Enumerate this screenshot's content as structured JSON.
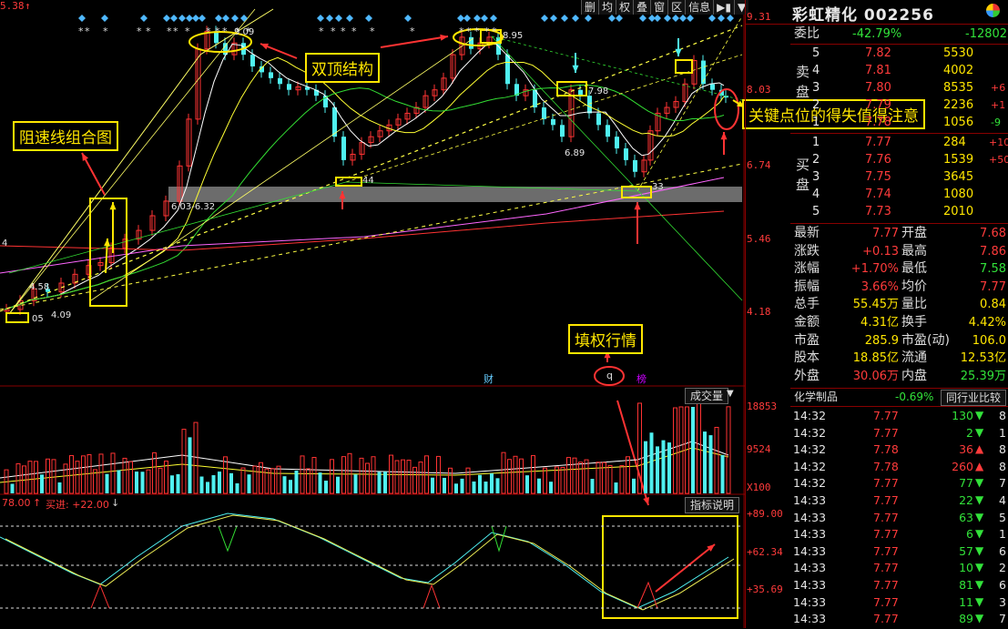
{
  "stock": {
    "name": "彩虹精化",
    "code": "002256"
  },
  "toolbar": [
    "删",
    "均",
    "权",
    "叠",
    "窗",
    "区",
    "信息"
  ],
  "price_axis": [
    "9.31",
    "8.03",
    "6.74",
    "5.46",
    "4.18"
  ],
  "top_left_price": "5.38",
  "chart_labels": {
    "l603": "6.03-6.32",
    "l689": "6.89",
    "l798": "7.98",
    "l458": "4.58",
    "l409": "4.09",
    "l405": "05",
    "l44": "44",
    "l33": "33",
    "l909": "9.09",
    "l895": "8.95",
    "l4": "4",
    "cai": "财",
    "q": "q",
    "bang": "榜"
  },
  "annotations": {
    "double_top": "双顶结构",
    "resist": "阻速线组合图",
    "key_point": "关键点位的得失值得注意",
    "ex_right": "填权行情"
  },
  "volume": {
    "label": "成交量",
    "axis": [
      "18853",
      "9524"
    ],
    "unit": "X100"
  },
  "indicator": {
    "left_text": "78.00",
    "buy_label": "买进: +22.00",
    "explain": "指标说明",
    "axis": [
      "+89.00",
      "+62.34",
      "+35.69"
    ]
  },
  "orderbook": {
    "weibi_label": "委比",
    "weibi_value": "-42.79%",
    "weibi_diff": "-12802",
    "sell_label": "卖盘",
    "buy_label": "买盘",
    "sell": [
      {
        "lvl": "5",
        "price": "7.82",
        "vol": "5530",
        "chg": ""
      },
      {
        "lvl": "4",
        "price": "7.81",
        "vol": "4002",
        "chg": ""
      },
      {
        "lvl": "3",
        "price": "7.80",
        "vol": "8535",
        "chg": "+6"
      },
      {
        "lvl": "2",
        "price": "7.79",
        "vol": "2236",
        "chg": "+1"
      },
      {
        "lvl": "1",
        "price": "7.78",
        "vol": "1056",
        "chg": "-9"
      }
    ],
    "buy": [
      {
        "lvl": "1",
        "price": "7.77",
        "vol": "284",
        "chg": "+10"
      },
      {
        "lvl": "2",
        "price": "7.76",
        "vol": "1539",
        "chg": "+50"
      },
      {
        "lvl": "3",
        "price": "7.75",
        "vol": "3645",
        "chg": ""
      },
      {
        "lvl": "4",
        "price": "7.74",
        "vol": "1080",
        "chg": ""
      },
      {
        "lvl": "5",
        "price": "7.73",
        "vol": "2010",
        "chg": ""
      }
    ]
  },
  "quote": [
    {
      "l1": "最新",
      "v1": "7.77",
      "l2": "开盘",
      "v2": "7.68"
    },
    {
      "l1": "涨跌",
      "v1": "+0.13",
      "l2": "最高",
      "v2": "7.86"
    },
    {
      "l1": "涨幅",
      "v1": "+1.70%",
      "l2": "最低",
      "v2": "7.58"
    },
    {
      "l1": "振幅",
      "v1": "3.66%",
      "l2": "均价",
      "v2": "7.77"
    },
    {
      "l1": "总手",
      "v1": "55.45万",
      "l2": "量比",
      "v2": "0.84"
    },
    {
      "l1": "金额",
      "v1": "4.31亿",
      "l2": "换手",
      "v2": "4.42%"
    },
    {
      "l1": "市盈",
      "v1": "285.9",
      "l2": "市盈(动)",
      "v2": "106.0"
    },
    {
      "l1": "股本",
      "v1": "18.85亿",
      "l2": "流通",
      "v2": "12.53亿"
    },
    {
      "l1": "外盘",
      "v1": "30.06万",
      "l2": "内盘",
      "v2": "25.39万"
    }
  ],
  "sector": {
    "name": "化学制品",
    "chg": "-0.69%",
    "btn": "同行业比较"
  },
  "ticks": [
    {
      "t": "14:32",
      "p": "7.77",
      "v": "130",
      "d": "down",
      "n": "8"
    },
    {
      "t": "14:32",
      "p": "7.77",
      "v": "2",
      "d": "down",
      "n": "1"
    },
    {
      "t": "14:32",
      "p": "7.78",
      "v": "36",
      "d": "up",
      "n": "8"
    },
    {
      "t": "14:32",
      "p": "7.78",
      "v": "260",
      "d": "up",
      "n": "8"
    },
    {
      "t": "14:32",
      "p": "7.77",
      "v": "77",
      "d": "down",
      "n": "7"
    },
    {
      "t": "14:33",
      "p": "7.77",
      "v": "22",
      "d": "down",
      "n": "4"
    },
    {
      "t": "14:33",
      "p": "7.77",
      "v": "63",
      "d": "down",
      "n": "5"
    },
    {
      "t": "14:33",
      "p": "7.77",
      "v": "6",
      "d": "down",
      "n": "1"
    },
    {
      "t": "14:33",
      "p": "7.77",
      "v": "57",
      "d": "down",
      "n": "6"
    },
    {
      "t": "14:33",
      "p": "7.77",
      "v": "10",
      "d": "down",
      "n": "2"
    },
    {
      "t": "14:33",
      "p": "7.77",
      "v": "81",
      "d": "down",
      "n": "6"
    },
    {
      "t": "14:33",
      "p": "7.77",
      "v": "11",
      "d": "down",
      "n": "3"
    },
    {
      "t": "14:33",
      "p": "7.77",
      "v": "89",
      "d": "down",
      "n": "7"
    }
  ]
}
